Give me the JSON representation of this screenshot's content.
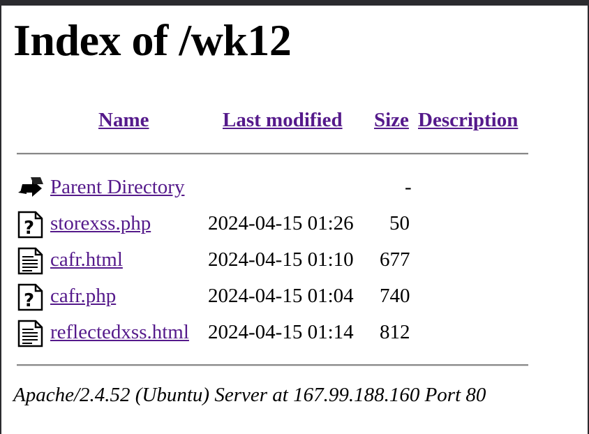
{
  "title": "Index of /wk12",
  "columns": {
    "name": "Name",
    "last_modified": "Last modified",
    "size": "Size",
    "description": "Description"
  },
  "parent": {
    "label": "Parent Directory",
    "size": "-",
    "icon": "back-arrow-icon"
  },
  "rows": [
    {
      "name": "storexss.php",
      "modified": "2024-04-15 01:26",
      "size": "50",
      "icon": "unknown-file-icon"
    },
    {
      "name": "cafr.html",
      "modified": "2024-04-15 01:10",
      "size": "677",
      "icon": "text-file-icon"
    },
    {
      "name": "cafr.php",
      "modified": "2024-04-15 01:04",
      "size": "740",
      "icon": "unknown-file-icon"
    },
    {
      "name": "reflectedxss.html",
      "modified": "2024-04-15 01:14",
      "size": "812",
      "icon": "text-file-icon"
    }
  ],
  "footer": "Apache/2.4.52 (Ubuntu) Server at 167.99.188.160 Port 80",
  "colors": {
    "link": "#551a8b",
    "rule": "#888888"
  }
}
